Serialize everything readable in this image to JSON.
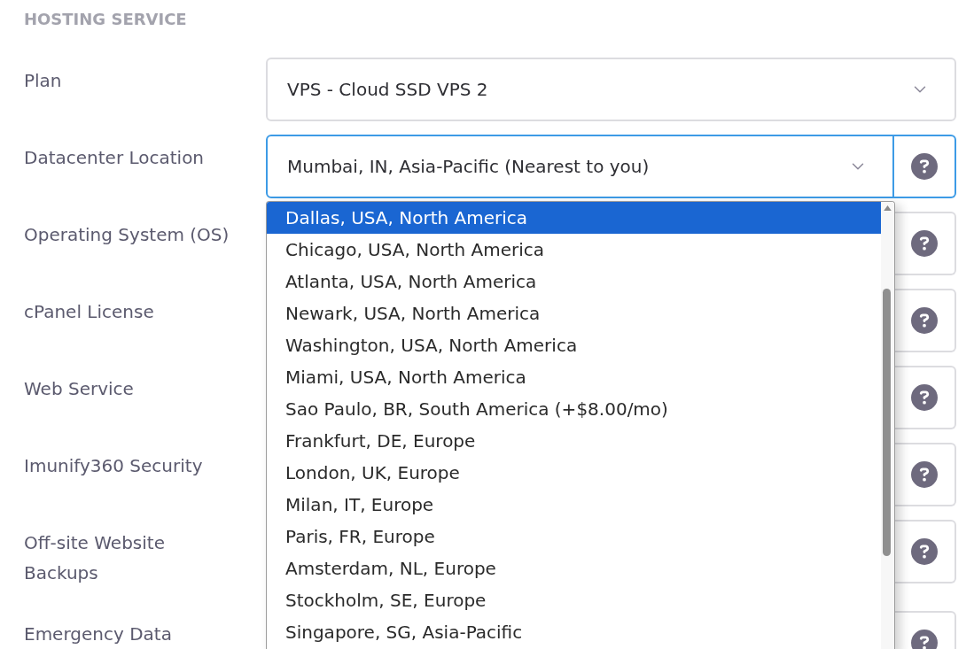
{
  "section": {
    "title": "HOSTING SERVICE"
  },
  "fields": [
    {
      "label": "Plan",
      "value": "VPS - Cloud SSD VPS 2",
      "help": false,
      "focused": false,
      "expanded": false
    },
    {
      "label": "Datacenter Location",
      "value": "Mumbai, IN, Asia-Pacific (Nearest to you)",
      "help": true,
      "focused": true,
      "expanded": true,
      "options": [
        {
          "label": "Dallas, USA, North America",
          "selected": true
        },
        {
          "label": "Chicago, USA, North America",
          "selected": false
        },
        {
          "label": "Atlanta, USA, North America",
          "selected": false
        },
        {
          "label": "Newark, USA, North America",
          "selected": false
        },
        {
          "label": "Washington, USA, North America",
          "selected": false
        },
        {
          "label": "Miami, USA, North America",
          "selected": false
        },
        {
          "label": "Sao Paulo, BR, South America (+$8.00/mo)",
          "selected": false
        },
        {
          "label": "Frankfurt, DE, Europe",
          "selected": false
        },
        {
          "label": "London, UK, Europe",
          "selected": false
        },
        {
          "label": "Milan, IT, Europe",
          "selected": false
        },
        {
          "label": "Paris, FR, Europe",
          "selected": false
        },
        {
          "label": "Amsterdam, NL, Europe",
          "selected": false
        },
        {
          "label": "Stockholm, SE, Europe",
          "selected": false
        },
        {
          "label": "Singapore, SG, Asia-Pacific",
          "selected": false
        }
      ]
    },
    {
      "label": "Operating System (OS)",
      "help": true,
      "focused": false,
      "expanded": false
    },
    {
      "label": "cPanel License",
      "help": true,
      "focused": false,
      "expanded": false
    },
    {
      "label": "Web Service",
      "help": true,
      "focused": false,
      "expanded": false
    },
    {
      "label": "Imunify360 Security",
      "help": true,
      "focused": false,
      "expanded": false
    },
    {
      "label": "Off-site Website Backups",
      "help": true,
      "focused": false,
      "expanded": false
    },
    {
      "label": "Emergency Data",
      "help": true,
      "focused": false,
      "expanded": false
    }
  ]
}
